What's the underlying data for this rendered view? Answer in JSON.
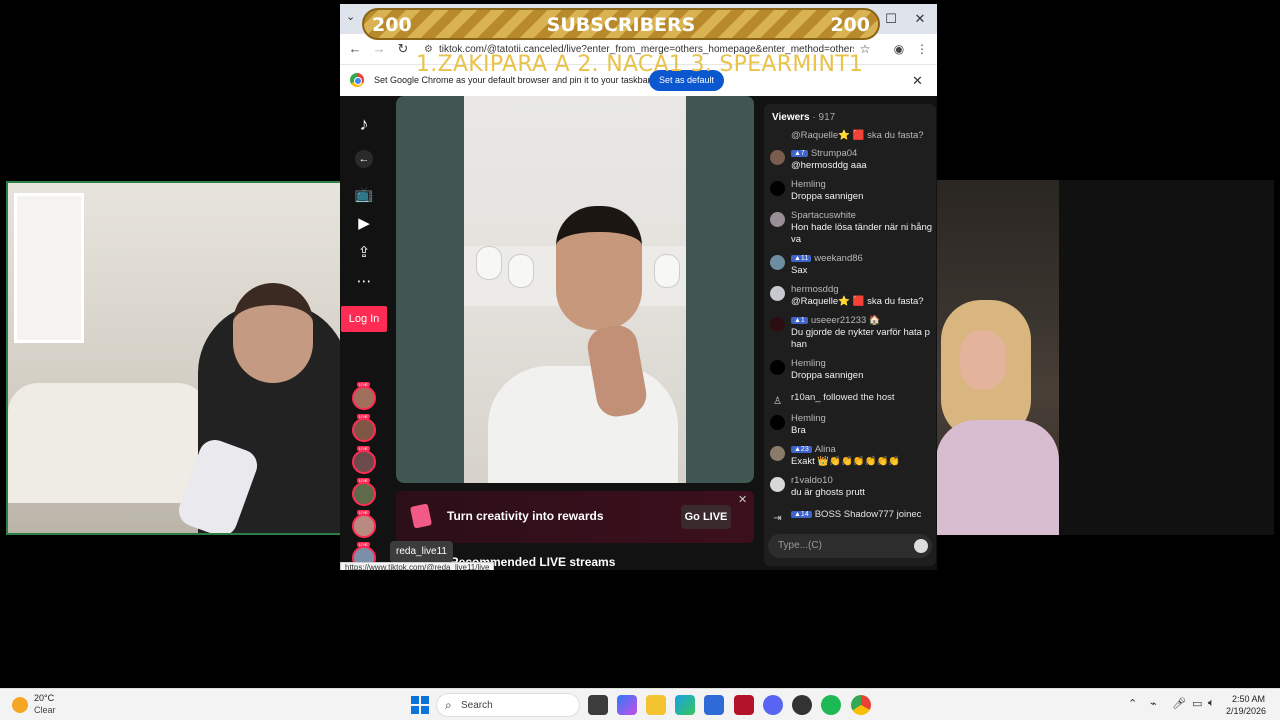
{
  "subscriber_banner": {
    "left_count": "200",
    "label": "SUBSCRIBERS",
    "right_count": "200"
  },
  "overlay_ranking": "1.ZAKIPARA A 2. NACA1  3.  SPEARMINT1",
  "browser": {
    "url": "tiktok.com/@tatotii.canceled/live?enter_from_merge=others_homepage&enter_method=others_...",
    "infobar_message": "Set Google Chrome as your default browser and pin it to your taskbar",
    "set_default_label": "Set as default",
    "status_url": "https://www.tiktok.com/@reda_live11/live"
  },
  "sidebar": {
    "login_label": "Log In",
    "live_tag": "LIVE",
    "hover_tooltip": "reda_live11"
  },
  "promo": {
    "title": "Turn creativity into rewards",
    "button": "Go LIVE"
  },
  "recommended_heading": "Recommended LIVE streams",
  "chat": {
    "viewers_label": "Viewers",
    "viewers_count": "· 917",
    "input_placeholder": "Type...(C)",
    "messages": [
      {
        "badge": "",
        "user": "@Raquelle⭐ 🟥 ska du fasta?",
        "text": ""
      },
      {
        "badge": "7",
        "user": "Strumpa04",
        "text": "@hermosddg aaa"
      },
      {
        "badge": "",
        "user": "Hemling",
        "text": "Droppa sannigen"
      },
      {
        "badge": "",
        "user": "Spartacuswhite",
        "text": "Hon hade lösa tänder när ni hång va"
      },
      {
        "badge": "11",
        "user": "weekand86",
        "text": "Sax"
      },
      {
        "badge": "",
        "user": "hermosddg",
        "text": "@Raquelle⭐ 🟥 ska du fasta?"
      },
      {
        "badge": "1",
        "user": "useeer21233 🏠",
        "text": "Du gjorde de nykter varför hata p han"
      },
      {
        "badge": "",
        "user": "Hemling",
        "text": "Droppa sannigen"
      },
      {
        "badge": "",
        "user": "r10an_  followed the host",
        "text": ""
      },
      {
        "badge": "",
        "user": "Hemling",
        "text": "Bra"
      },
      {
        "badge": "23",
        "user": "Alina",
        "text": "Exakt 👑👏👏👏👏👏👏"
      },
      {
        "badge": "",
        "user": "r1valdo10",
        "text": "du är ghosts prutt"
      },
      {
        "badge": "14",
        "user": "BOSS Shadow777  joinec",
        "text": ""
      }
    ]
  },
  "taskbar": {
    "temperature": "20°C",
    "weather": "Clear",
    "search_label": "Search",
    "time": "2:50 AM",
    "date": "2/19/2026"
  },
  "colors": {
    "tiktok_red": "#fe2c55",
    "chrome_blue": "#0b57d0",
    "banner_gold": "#d9b253"
  }
}
